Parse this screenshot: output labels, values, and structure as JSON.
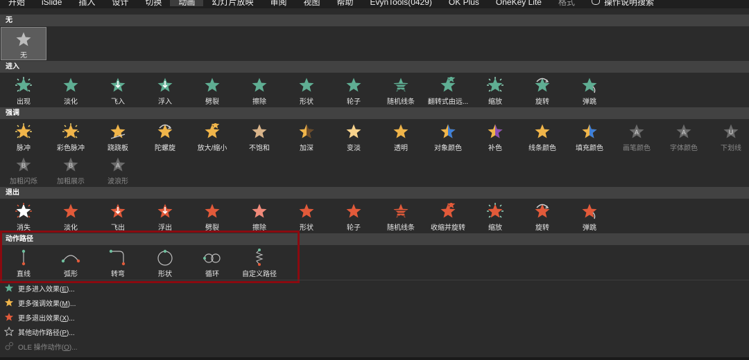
{
  "ribbon": {
    "tabs": [
      "开始",
      "iSlide",
      "插入",
      "设计",
      "切换",
      "动画",
      "幻灯片放映",
      "审阅",
      "视图",
      "帮助",
      "EvynTools(0429)",
      "OK Plus",
      "OneKey Lite",
      "格式"
    ],
    "active_tab": "动画",
    "tell_me": "操作说明搜索"
  },
  "sections": {
    "none": "无",
    "entrance": "进入",
    "emphasis": "强调",
    "exit": "退出",
    "motion_paths": "动作路径"
  },
  "none_items": [
    {
      "label": "无",
      "icon": "star-gray-icon"
    }
  ],
  "entrance_items": [
    {
      "label": "出现",
      "icon": "star-green-burst-icon"
    },
    {
      "label": "淡化",
      "icon": "star-green-icon"
    },
    {
      "label": "飞入",
      "icon": "star-green-arrow-icon"
    },
    {
      "label": "浮入",
      "icon": "star-green-arrow-icon"
    },
    {
      "label": "劈裂",
      "icon": "star-green-icon"
    },
    {
      "label": "擦除",
      "icon": "star-green-icon"
    },
    {
      "label": "形状",
      "icon": "star-green-icon"
    },
    {
      "label": "轮子",
      "icon": "star-green-icon"
    },
    {
      "label": "随机线条",
      "icon": "star-green-lines-icon"
    },
    {
      "label": "翻转式由远...",
      "icon": "star-green-pair-icon"
    },
    {
      "label": "缩放",
      "icon": "star-green-burst-icon"
    },
    {
      "label": "旋转",
      "icon": "star-green-spin-icon"
    },
    {
      "label": "弹跳",
      "icon": "star-green-bounce-icon"
    }
  ],
  "emphasis_items": [
    {
      "label": "脉冲",
      "icon": "star-gold-glow-icon",
      "dim": false
    },
    {
      "label": "彩色脉冲",
      "icon": "star-gold-burst-icon",
      "dim": false
    },
    {
      "label": "跷跷板",
      "icon": "star-gold-tilt-icon",
      "dim": false
    },
    {
      "label": "陀螺旋",
      "icon": "star-gold-spin-icon",
      "dim": false
    },
    {
      "label": "放大/缩小",
      "icon": "star-gold-pair-icon",
      "dim": false
    },
    {
      "label": "不饱和",
      "icon": "star-tan-icon",
      "dim": false
    },
    {
      "label": "加深",
      "icon": "star-gold-dark-icon",
      "dim": false
    },
    {
      "label": "变淡",
      "icon": "star-light-gold-icon",
      "dim": false
    },
    {
      "label": "透明",
      "icon": "star-gold-icon",
      "dim": false
    },
    {
      "label": "对象颜色",
      "icon": "star-gold-blue-icon",
      "dim": false
    },
    {
      "label": "补色",
      "icon": "star-gold-purple-icon",
      "dim": false
    },
    {
      "label": "线条颜色",
      "icon": "star-gold-icon",
      "dim": false
    },
    {
      "label": "填充颜色",
      "icon": "star-gold-blue-icon",
      "dim": false
    },
    {
      "label": "画笔颜色",
      "icon": "star-letter-a-icon",
      "dim": true
    },
    {
      "label": "字体颜色",
      "icon": "star-letter-a-icon",
      "dim": true
    },
    {
      "label": "下划线",
      "icon": "star-letter-u-icon",
      "dim": true
    },
    {
      "label": "加粗闪烁",
      "icon": "star-letter-b-icon",
      "dim": true
    },
    {
      "label": "加粗展示",
      "icon": "star-letter-b-icon",
      "dim": true
    },
    {
      "label": "波浪形",
      "icon": "star-letter-a-icon",
      "dim": true
    }
  ],
  "exit_items": [
    {
      "label": "消失",
      "icon": "star-white-burst-icon"
    },
    {
      "label": "淡化",
      "icon": "star-red-icon"
    },
    {
      "label": "飞出",
      "icon": "star-red-arrow-icon"
    },
    {
      "label": "浮出",
      "icon": "star-red-arrow-icon"
    },
    {
      "label": "劈裂",
      "icon": "star-red-icon"
    },
    {
      "label": "擦除",
      "icon": "star-pink-icon"
    },
    {
      "label": "形状",
      "icon": "star-red-icon"
    },
    {
      "label": "轮子",
      "icon": "star-red-icon"
    },
    {
      "label": "随机线条",
      "icon": "star-red-lines-icon"
    },
    {
      "label": "收缩并旋转",
      "icon": "star-red-pair-icon"
    },
    {
      "label": "缩放",
      "icon": "star-red-burst-icon"
    },
    {
      "label": "旋转",
      "icon": "star-red-spin-icon"
    },
    {
      "label": "弹跳",
      "icon": "star-red-bounce-icon"
    }
  ],
  "path_items": [
    {
      "label": "直线",
      "icon": "line-path-icon"
    },
    {
      "label": "弧形",
      "icon": "arc-path-icon"
    },
    {
      "label": "转弯",
      "icon": "turn-path-icon"
    },
    {
      "label": "形状",
      "icon": "circle-path-icon"
    },
    {
      "label": "循环",
      "icon": "loop-path-icon"
    },
    {
      "label": "自定义路径",
      "icon": "custom-path-icon"
    }
  ],
  "more_menu": [
    {
      "label": "更多进入效果(",
      "key": "E",
      "tail": ")...",
      "icon": "star-green-icon",
      "dim": false
    },
    {
      "label": "更多强调效果(",
      "key": "M",
      "tail": ")...",
      "icon": "star-gold-icon",
      "dim": false
    },
    {
      "label": "更多退出效果(",
      "key": "X",
      "tail": ")...",
      "icon": "star-red-icon",
      "dim": false
    },
    {
      "label": "其他动作路径(",
      "key": "P",
      "tail": ")...",
      "icon": "star-outline-icon",
      "dim": false
    },
    {
      "label": "OLE 操作动作(",
      "key": "O",
      "tail": ")...",
      "icon": "ole-action-icon",
      "dim": true
    }
  ],
  "colors": {
    "green": "#5fae93",
    "gold": "#f0b54a",
    "red": "#e25a3a",
    "highlight_border": "#8b0a10",
    "section_bg": "#424242",
    "panel_bg": "#2b2b2b"
  }
}
